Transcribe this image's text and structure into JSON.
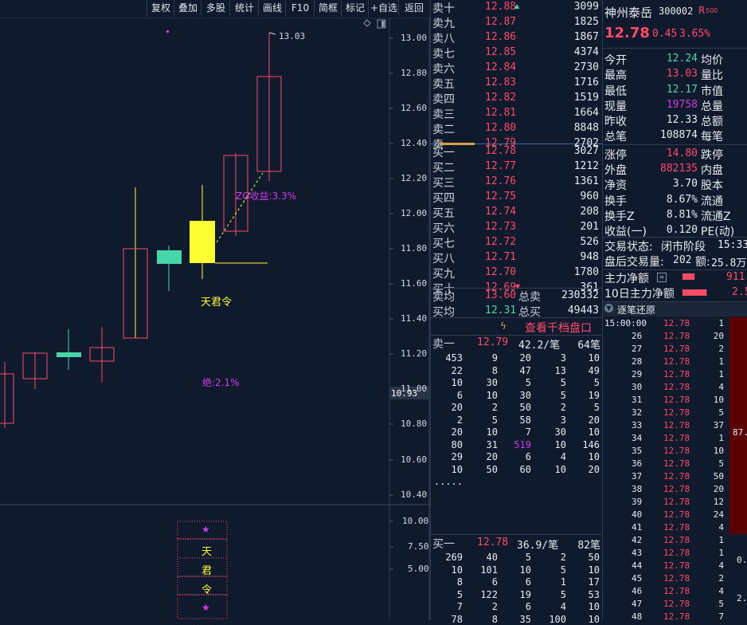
{
  "toolbar": {
    "buttons": [
      "复权",
      "叠加",
      "多股",
      "统计",
      "画线",
      "F10",
      "简框",
      "标记",
      "+自选",
      "返回"
    ]
  },
  "chart": {
    "price_axis": [
      "13.00",
      "12.80",
      "12.60",
      "12.40",
      "12.20",
      "12.00",
      "11.80",
      "11.60",
      "11.40",
      "11.20",
      "11.00",
      "10.80",
      "10.60",
      "10.40"
    ],
    "current_price_tag": "10.93",
    "high_annotation": "13.03",
    "zg_label": "ZG收益:3.3%",
    "signal_label": "天君令",
    "pct_label": "绝:2.1%",
    "sub_axis": [
      "10.00",
      "7.50",
      "5.00"
    ],
    "sub_chars": [
      "★",
      "天",
      "君",
      "令",
      "★"
    ],
    "colors": {
      "up": "#ff4a6a",
      "down": "#46d6a8",
      "signal": "#ffff33",
      "label": "#d23be8"
    }
  },
  "sell_book": [
    {
      "label": "卖十",
      "price": "12.88",
      "vol": "3099"
    },
    {
      "label": "卖九",
      "price": "12.87",
      "vol": "1825"
    },
    {
      "label": "卖八",
      "price": "12.86",
      "vol": "1867"
    },
    {
      "label": "卖七",
      "price": "12.85",
      "vol": "4374"
    },
    {
      "label": "卖六",
      "price": "12.84",
      "vol": "2730"
    },
    {
      "label": "卖五",
      "price": "12.83",
      "vol": "1716"
    },
    {
      "label": "卖四",
      "price": "12.82",
      "vol": "1519"
    },
    {
      "label": "卖三",
      "price": "12.81",
      "vol": "1664"
    },
    {
      "label": "卖二",
      "price": "12.80",
      "vol": "8848"
    },
    {
      "label": "卖一",
      "price": "12.79",
      "vol": "2702"
    }
  ],
  "buy_book": [
    {
      "label": "买一",
      "price": "12.78",
      "vol": "3027"
    },
    {
      "label": "买二",
      "price": "12.77",
      "vol": "1212"
    },
    {
      "label": "买三",
      "price": "12.76",
      "vol": "1361"
    },
    {
      "label": "买四",
      "price": "12.75",
      "vol": "960"
    },
    {
      "label": "买五",
      "price": "12.74",
      "vol": "208"
    },
    {
      "label": "买六",
      "price": "12.73",
      "vol": "201"
    },
    {
      "label": "买七",
      "price": "12.72",
      "vol": "526"
    },
    {
      "label": "买八",
      "price": "12.71",
      "vol": "948"
    },
    {
      "label": "买九",
      "price": "12.70",
      "vol": "1780"
    },
    {
      "label": "买十",
      "price": "12.69",
      "vol": "361"
    }
  ],
  "avg": {
    "sell_avg_label": "卖均",
    "sell_avg": "13.60",
    "total_sell_label": "总卖",
    "total_sell": "230332",
    "buy_avg_label": "买均",
    "buy_avg": "12.31",
    "total_buy_label": "总买",
    "total_buy": "49443"
  },
  "thousand_link": "查看千档盘口",
  "queue_sell": {
    "label": "卖一",
    "price": "12.79",
    "avg": "42.2/笔",
    "count": "64笔",
    "rows": [
      [
        "453",
        "9",
        "20",
        "3",
        "10"
      ],
      [
        "22",
        "8",
        "47",
        "13",
        "49"
      ],
      [
        "10",
        "30",
        "5",
        "5",
        "5"
      ],
      [
        "6",
        "10",
        "30",
        "5",
        "19"
      ],
      [
        "20",
        "2",
        "50",
        "2",
        "5"
      ],
      [
        "2",
        "5",
        "58",
        "3",
        "20"
      ],
      [
        "20",
        "10",
        "7",
        "30",
        "10"
      ],
      [
        "80",
        "31",
        "519",
        "10",
        "146"
      ],
      [
        "29",
        "20",
        "6",
        "4",
        "10"
      ],
      [
        "10",
        "50",
        "60",
        "10",
        "20"
      ]
    ],
    "more": "....."
  },
  "queue_buy": {
    "label": "买一",
    "price": "12.78",
    "avg": "36.9/笔",
    "count": "82笔",
    "rows": [
      [
        "269",
        "40",
        "5",
        "2",
        "50"
      ],
      [
        "10",
        "101",
        "10",
        "5",
        "10"
      ],
      [
        "8",
        "6",
        "6",
        "1",
        "17"
      ],
      [
        "5",
        "122",
        "19",
        "5",
        "53"
      ],
      [
        "7",
        "2",
        "6",
        "4",
        "10"
      ],
      [
        "78",
        "8",
        "35",
        "100",
        "10"
      ]
    ]
  },
  "stock": {
    "name": "神州泰岳",
    "code": "300002",
    "tag": "R",
    "tag_sub": "500",
    "price": "12.78",
    "change": "0.45",
    "pct": "3.65%"
  },
  "stats": [
    {
      "l": "今开",
      "v": "12.24",
      "c": "green",
      "r": "均价"
    },
    {
      "l": "最高",
      "v": "13.03",
      "c": "red",
      "r": "量比"
    },
    {
      "l": "最低",
      "v": "12.17",
      "c": "green",
      "r": "市值"
    },
    {
      "l": "现量",
      "v": "19758",
      "c": "magenta",
      "r": "总量"
    },
    {
      "l": "昨收",
      "v": "12.33",
      "c": "white",
      "r": "总额"
    },
    {
      "l": "总笔",
      "v": "108874",
      "c": "white",
      "r": "每笔"
    },
    {
      "l": "涨停",
      "v": "14.80",
      "c": "red",
      "r": "跌停"
    },
    {
      "l": "外盘",
      "v": "882135",
      "c": "red",
      "r": "内盘"
    },
    {
      "l": "净资",
      "v": "3.70",
      "c": "white",
      "r": "股本"
    },
    {
      "l": "换手",
      "v": "8.67%",
      "c": "white",
      "r": "流通"
    },
    {
      "l": "换手Z",
      "v": "8.81%",
      "c": "white",
      "r": "流通Z"
    },
    {
      "l": "收益(一)",
      "v": "0.120",
      "c": "white",
      "r": "PE(动)"
    }
  ],
  "trade_status": {
    "label": "交易状态:",
    "value": "闭市阶段",
    "time": "15:33:"
  },
  "after_hours": {
    "label": "盘后交易量:",
    "vol": "202",
    "amt_label": "额:",
    "amt": "25.8万"
  },
  "main_flow": {
    "label": "主力净额",
    "value": "911",
    "flow_pct": 0.4
  },
  "main_flow_10d": {
    "label": "10日主力净额",
    "value": "2.5",
    "flow_pct": 0.8
  },
  "tick_header": "逐笔还原",
  "ticks": [
    [
      "15:00:00",
      "12.78",
      "1"
    ],
    [
      "26",
      "12.78",
      "20"
    ],
    [
      "27",
      "12.78",
      "2"
    ],
    [
      "28",
      "12.78",
      "1"
    ],
    [
      "29",
      "12.78",
      "1"
    ],
    [
      "30",
      "12.78",
      "4"
    ],
    [
      "31",
      "12.78",
      "10"
    ],
    [
      "32",
      "12.78",
      "5"
    ],
    [
      "33",
      "12.78",
      "37"
    ],
    [
      "34",
      "12.78",
      "1"
    ],
    [
      "35",
      "12.78",
      "10"
    ],
    [
      "36",
      "12.78",
      "5"
    ],
    [
      "37",
      "12.78",
      "50"
    ],
    [
      "38",
      "12.78",
      "20"
    ],
    [
      "39",
      "12.78",
      "12"
    ],
    [
      "40",
      "12.78",
      "24"
    ],
    [
      "41",
      "12.78",
      "4"
    ],
    [
      "42",
      "12.78",
      "1"
    ],
    [
      "43",
      "12.78",
      "1"
    ],
    [
      "44",
      "12.78",
      "4"
    ],
    [
      "45",
      "12.78",
      "2"
    ],
    [
      "46",
      "12.78",
      "4"
    ],
    [
      "47",
      "12.78",
      "5"
    ],
    [
      "48",
      "12.78",
      "7"
    ]
  ],
  "side_labels": {
    "a": "87.",
    "b": "0.",
    "c": "2."
  }
}
